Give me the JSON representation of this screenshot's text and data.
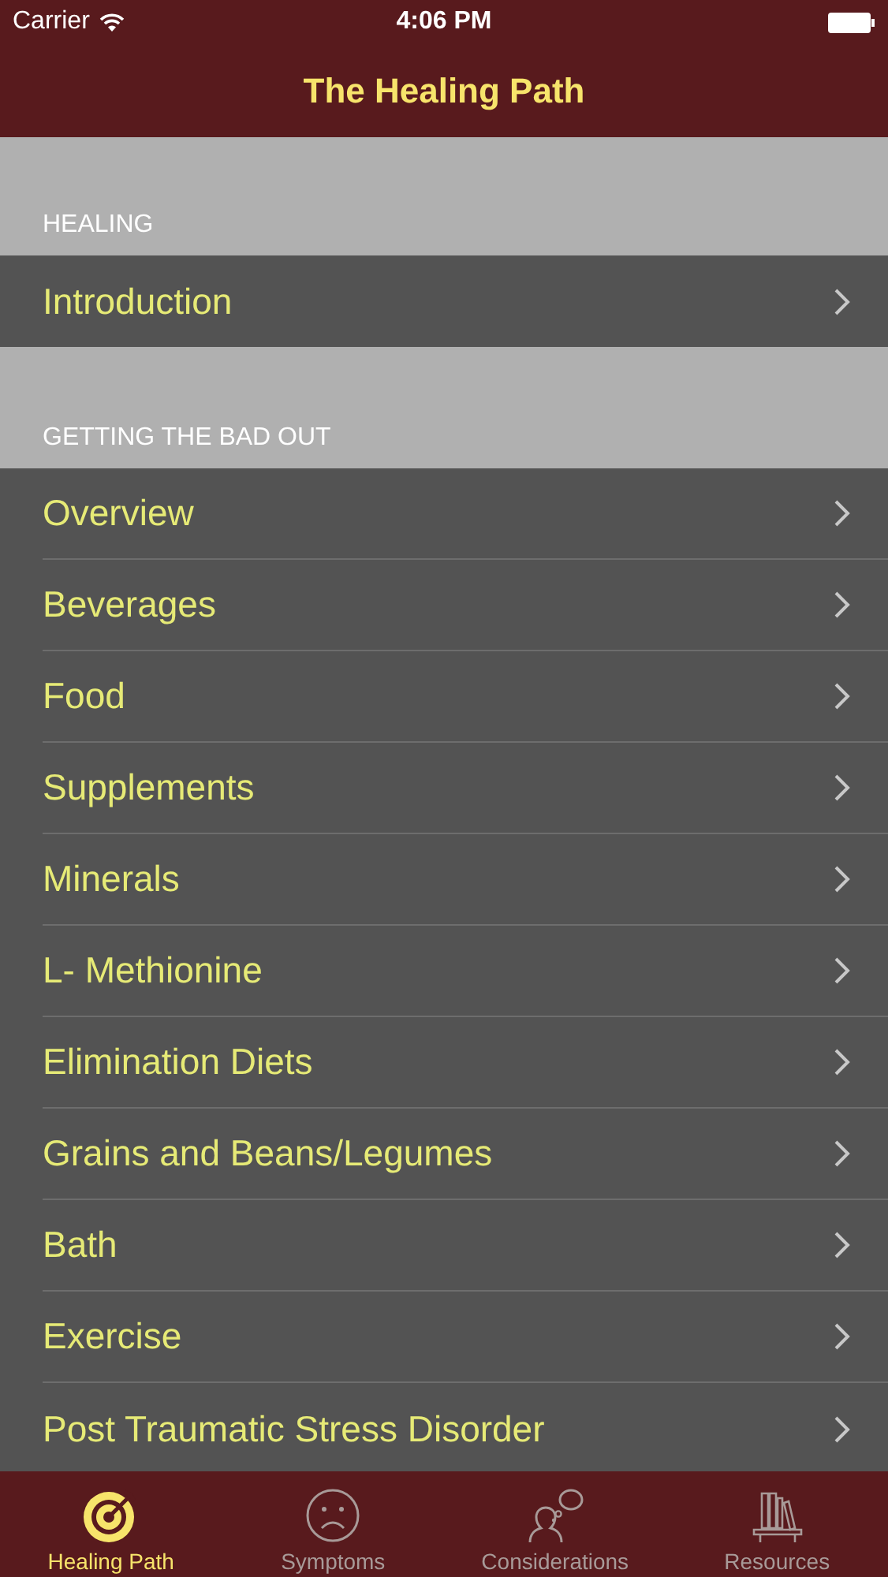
{
  "status_bar": {
    "carrier": "Carrier",
    "time": "4:06 PM"
  },
  "nav_bar": {
    "title": "The Healing Path"
  },
  "sections": [
    {
      "header": "HEALING",
      "items": [
        "Introduction"
      ]
    },
    {
      "header": "GETTING THE BAD OUT",
      "items": [
        "Overview",
        "Beverages",
        "Food",
        "Supplements",
        "Minerals",
        "L- Methionine",
        "Elimination Diets",
        "Grains and Beans/Legumes",
        "Bath",
        "Exercise",
        "Post Traumatic Stress Disorder"
      ]
    }
  ],
  "tab_bar": [
    {
      "kind": "target",
      "label": "Healing Path",
      "selected": true
    },
    {
      "kind": "sad",
      "label": "Symptoms",
      "selected": false
    },
    {
      "kind": "thought",
      "label": "Considerations",
      "selected": false
    },
    {
      "kind": "books",
      "label": "Resources",
      "selected": false
    }
  ]
}
